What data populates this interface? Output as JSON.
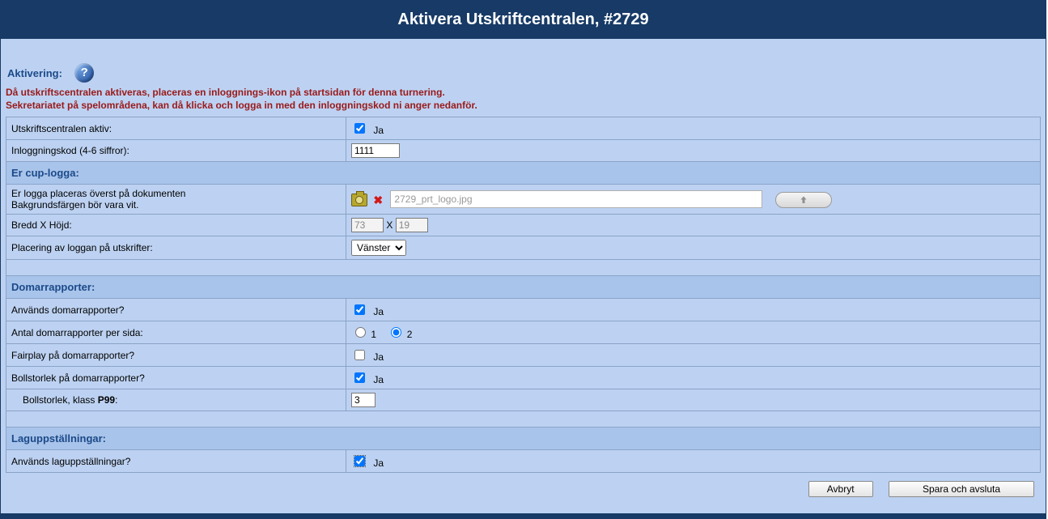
{
  "header": {
    "title": "Aktivera Utskriftcentralen, #2729"
  },
  "activation": {
    "heading": "Aktivering:",
    "desc1": "Då utskriftscentralen aktiveras, placeras en inloggnings-ikon på startsidan för denna turnering.",
    "desc2": "Sekretariatet på spelområdena, kan då klicka och logga in med den inloggningskod ni anger nedanför.",
    "active_label": "Utskriftscentralen aktiv:",
    "active_value_text": "Ja",
    "code_label": "Inloggningskod (4-6 siffror):",
    "code_value": "1111"
  },
  "logo": {
    "heading": "Er cup-logga:",
    "placement_desc1": "Er logga placeras överst på dokumenten",
    "placement_desc2": "Bakgrundsfärgen bör vara vit.",
    "filename": "2729_prt_logo.jpg",
    "size_label": "Bredd X Höjd:",
    "width": "73",
    "height": "19",
    "size_sep": "X",
    "position_label": "Placering av loggan på utskrifter:",
    "position_value": "Vänster"
  },
  "referee": {
    "heading": "Domarrapporter:",
    "use_label": "Används domarrapporter?",
    "use_text": "Ja",
    "per_page_label": "Antal domarrapporter per sida:",
    "opt1": "1",
    "opt2": "2",
    "fairplay_label": "Fairplay på domarrapporter?",
    "fairplay_text": "Ja",
    "ballsize_label": "Bollstorlek på domarrapporter?",
    "ballsize_text": "Ja",
    "ballsize_class_label_pre": "Bollstorlek, klass ",
    "ballsize_class_bold": "P99",
    "ballsize_class_label_post": ":",
    "ballsize_value": "3"
  },
  "lineups": {
    "heading": "Laguppställningar:",
    "use_label": "Används laguppställningar?",
    "use_text": "Ja"
  },
  "footer": {
    "cancel": "Avbryt",
    "save": "Spara och avsluta"
  }
}
